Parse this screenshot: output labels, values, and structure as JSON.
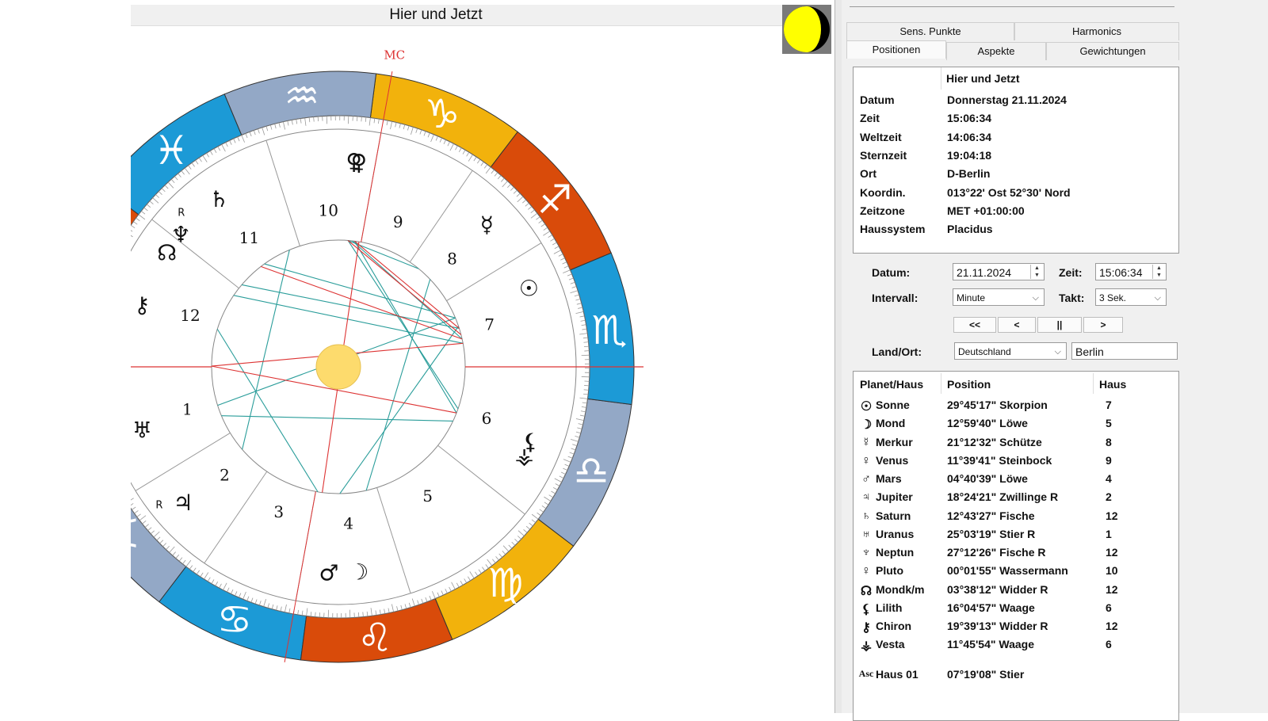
{
  "chart": {
    "title": "Hier und Jetzt",
    "houses": [
      "1",
      "2",
      "3",
      "4",
      "5",
      "6",
      "7",
      "8",
      "9",
      "10",
      "11",
      "12"
    ],
    "mc_label": "MC",
    "zodiac": [
      {
        "glyph": "♈",
        "color": "#d94b0a"
      },
      {
        "glyph": "♉",
        "color": "#f2b20c"
      },
      {
        "glyph": "♊",
        "color": "#93a8c6"
      },
      {
        "glyph": "♋",
        "color": "#1c9ad6"
      },
      {
        "glyph": "♌",
        "color": "#d94b0a"
      },
      {
        "glyph": "♍",
        "color": "#f2b20c"
      },
      {
        "glyph": "♎",
        "color": "#93a8c6"
      },
      {
        "glyph": "♏",
        "color": "#1c9ad6"
      },
      {
        "glyph": "♐",
        "color": "#d94b0a"
      },
      {
        "glyph": "♑",
        "color": "#f2b20c"
      },
      {
        "glyph": "♒",
        "color": "#93a8c6"
      },
      {
        "glyph": "♓",
        "color": "#1c9ad6"
      }
    ],
    "planets": [
      {
        "glyph": "♀"
      },
      {
        "glyph": "♀"
      },
      {
        "glyph": "☿"
      },
      {
        "glyph": "☉"
      },
      {
        "glyph": "♄"
      },
      {
        "glyph": "♆"
      },
      {
        "glyph": "R"
      },
      {
        "glyph": "☊"
      },
      {
        "glyph": "⚸"
      },
      {
        "glyph": "⚶"
      },
      {
        "glyph": "⚷"
      },
      {
        "glyph": "♂"
      },
      {
        "glyph": "☽"
      },
      {
        "glyph": "♃"
      },
      {
        "glyph": "R"
      },
      {
        "glyph": "♅"
      }
    ]
  },
  "panel": {
    "tabs_row1": [
      "Sens. Punkte",
      "Harmonics"
    ],
    "tabs_row2": [
      "Positionen",
      "Aspekte",
      "Gewichtungen"
    ],
    "info": {
      "title": "Hier und Jetzt",
      "rows": [
        {
          "label": "Datum",
          "value": "Donnerstag 21.11.2024"
        },
        {
          "label": "Zeit",
          "value": "15:06:34"
        },
        {
          "label": "Weltzeit",
          "value": "14:06:34"
        },
        {
          "label": "Sternzeit",
          "value": "19:04:18"
        },
        {
          "label": "Ort",
          "value": "D-Berlin"
        },
        {
          "label": "Koordin.",
          "value": "013°22' Ost 52°30' Nord"
        },
        {
          "label": "Zeitzone",
          "value": "MET +01:00:00"
        },
        {
          "label": "Haussystem",
          "value": "Placidus"
        }
      ]
    },
    "controls": {
      "datum_label": "Datum:",
      "datum_value": "21.11.2024",
      "zeit_label": "Zeit:",
      "zeit_value": "15:06:34",
      "intervall_label": "Intervall:",
      "intervall_value": "Minute",
      "takt_label": "Takt:",
      "takt_value": "3 Sek.",
      "buttons": [
        "<<",
        "<",
        "||",
        ">"
      ],
      "land_label": "Land/Ort:",
      "land_value": "Deutschland",
      "ort_value": "Berlin"
    },
    "positions": {
      "headers": [
        "Planet/Haus",
        "Position",
        "Haus"
      ],
      "rows": [
        {
          "glyph": "☉",
          "name": "Sonne",
          "pos": "29°45'17\" Skorpion",
          "house": "7"
        },
        {
          "glyph": "☽",
          "name": "Mond",
          "pos": "12°59'40\" Löwe",
          "house": "5"
        },
        {
          "glyph": "☿",
          "name": "Merkur",
          "pos": "21°12'32\" Schütze",
          "house": "8"
        },
        {
          "glyph": "♀",
          "name": "Venus",
          "pos": "11°39'41\" Steinbock",
          "house": "9"
        },
        {
          "glyph": "♂",
          "name": "Mars",
          "pos": "04°40'39\" Löwe",
          "house": "4"
        },
        {
          "glyph": "♃",
          "name": "Jupiter",
          "pos": "18°24'21\" Zwillinge R",
          "house": "2"
        },
        {
          "glyph": "♄",
          "name": "Saturn",
          "pos": "12°43'27\" Fische",
          "house": "12"
        },
        {
          "glyph": "♅",
          "name": "Uranus",
          "pos": "25°03'19\" Stier R",
          "house": "1"
        },
        {
          "glyph": "♆",
          "name": "Neptun",
          "pos": "27°12'26\" Fische R",
          "house": "12"
        },
        {
          "glyph": "♀",
          "name": "Pluto",
          "pos": "00°01'55\" Wassermann",
          "house": "10"
        },
        {
          "glyph": "☊",
          "name": "Mondk/m",
          "pos": "03°38'12\" Widder R",
          "house": "12"
        },
        {
          "glyph": "⚸",
          "name": "Lilith",
          "pos": "16°04'57\" Waage",
          "house": "6"
        },
        {
          "glyph": "⚷",
          "name": "Chiron",
          "pos": "19°39'13\" Widder R",
          "house": "12"
        },
        {
          "glyph": "⚶",
          "name": "Vesta",
          "pos": "11°45'54\" Waage",
          "house": "6"
        }
      ],
      "asc_row": {
        "glyph": "Asc",
        "name": "Haus 01",
        "pos": "07°19'08\" Stier",
        "house": ""
      }
    }
  }
}
